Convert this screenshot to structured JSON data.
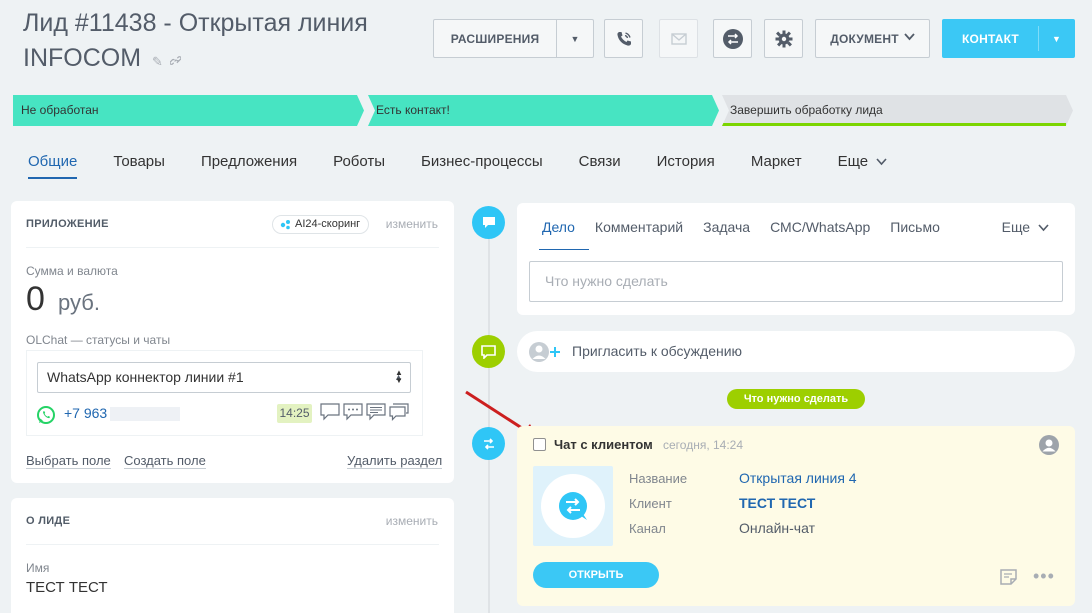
{
  "header": {
    "title": "Лид #11438 - Открытая линия INFOCOM",
    "pencil_icon": "✎",
    "extensions_label": "РАСШИРЕНИЯ",
    "document_label": "ДОКУМЕНТ",
    "contact_label": "КОНТАКТ",
    "icons": [
      "phone-icon",
      "mail-icon",
      "openline-icon",
      "gear-icon"
    ]
  },
  "stages": [
    {
      "label": "Не обработан",
      "color": "#47e4c2"
    },
    {
      "label": "Есть контакт!",
      "color": "#47e4c2"
    },
    {
      "label": "Завершить обработку лида",
      "color": "#dfe2e5"
    }
  ],
  "tabs": [
    {
      "label": "Общие",
      "active": true
    },
    {
      "label": "Товары"
    },
    {
      "label": "Предложения"
    },
    {
      "label": "Роботы"
    },
    {
      "label": "Бизнес-процессы"
    },
    {
      "label": "Связи"
    },
    {
      "label": "История"
    },
    {
      "label": "Маркет"
    },
    {
      "label": "Еще"
    }
  ],
  "app_section": {
    "title": "ПРИЛОЖЕНИЕ",
    "badge": "AI24-скоринг",
    "change": "изменить",
    "sum_label": "Сумма и валюта",
    "sum_value": "0",
    "currency": "руб.",
    "olchat_label": "OLChat — статусы и чаты",
    "connector": "WhatsApp коннектор линии #1",
    "phone": "+7 963",
    "time": "14:25",
    "select_field": "Выбрать поле",
    "create_field": "Создать поле",
    "delete_section": "Удалить раздел"
  },
  "lead_section": {
    "title": "О ЛИДЕ",
    "change": "изменить",
    "name_label": "Имя",
    "name_value": "ТЕСТ ТЕСТ"
  },
  "editor": {
    "tabs": [
      "Дело",
      "Комментарий",
      "Задача",
      "СМС/WhatsApp",
      "Письмо"
    ],
    "more": "Еще",
    "placeholder": "Что нужно сделать"
  },
  "invite": {
    "text": "Пригласить к обсуждению"
  },
  "todo_pill": "Что нужно сделать",
  "chat_item": {
    "title": "Чат с клиентом",
    "time": "сегодня, 14:24",
    "fields": [
      {
        "label": "Название",
        "value": "Открытая линия 4",
        "style": "link"
      },
      {
        "label": "Клиент",
        "value": "ТЕСТ ТЕСТ",
        "style": "bold-link"
      },
      {
        "label": "Канал",
        "value": "Онлайн-чат",
        "style": "plain"
      }
    ],
    "open_button": "ОТКРЫТЬ",
    "more": "•••"
  },
  "colors": {
    "accent": "#3bc8f5",
    "link": "#2067b0",
    "stage_done": "#47e4c2",
    "green": "#9dcf00",
    "whatsapp": "#25d366"
  }
}
